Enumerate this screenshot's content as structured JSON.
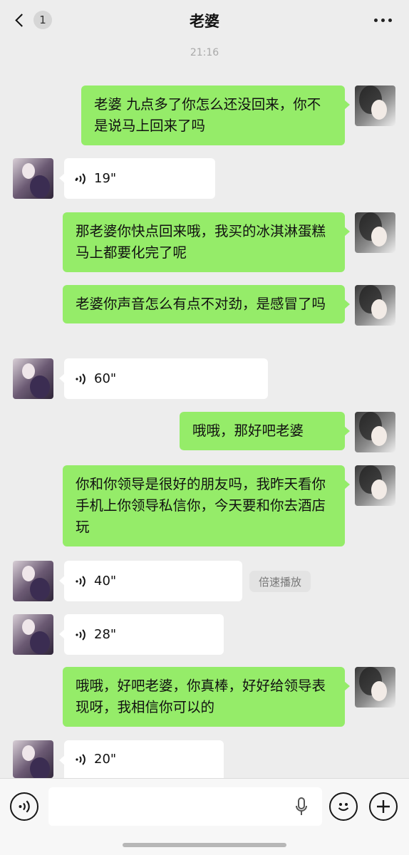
{
  "header": {
    "back_count": "1",
    "title": "老婆",
    "back_icon": "chevron-left-icon",
    "more_icon": "more-dots-icon"
  },
  "timestamp": "21:16",
  "messages": [
    {
      "from": "me",
      "text": "老婆 九点多了你怎么还没回来，你不是说马上回来了吗"
    },
    {
      "from": "them",
      "type": "voice",
      "duration": "19\""
    },
    {
      "from": "me",
      "text": "那老婆你快点回来哦，我买的冰淇淋蛋糕马上都要化完了呢"
    },
    {
      "from": "me",
      "text": "老婆你声音怎么有点不对劲，是感冒了吗"
    },
    {
      "from": "them",
      "type": "voice",
      "duration": "60\""
    },
    {
      "from": "me",
      "text": "哦哦，那好吧老婆"
    },
    {
      "from": "me",
      "text": "你和你领导是很好的朋友吗，我昨天看你手机上你领导私信你，今天要和你去酒店玩"
    },
    {
      "from": "them",
      "type": "voice",
      "duration": "40\"",
      "action": "倍速播放"
    },
    {
      "from": "them",
      "type": "voice",
      "duration": "28\""
    },
    {
      "from": "me",
      "text": "哦哦，好吧老婆，你真棒，好好给领导表现呀，我相信你可以的"
    },
    {
      "from": "them",
      "type": "voice",
      "duration": "20\""
    }
  ],
  "input_bar": {
    "voice_icon": "voice-mode-icon",
    "mic_icon": "microphone-icon",
    "emoji_icon": "emoji-icon",
    "plus_icon": "plus-icon"
  },
  "colors": {
    "background": "#ededed",
    "my_bubble": "#95ec69",
    "their_bubble": "#ffffff"
  }
}
